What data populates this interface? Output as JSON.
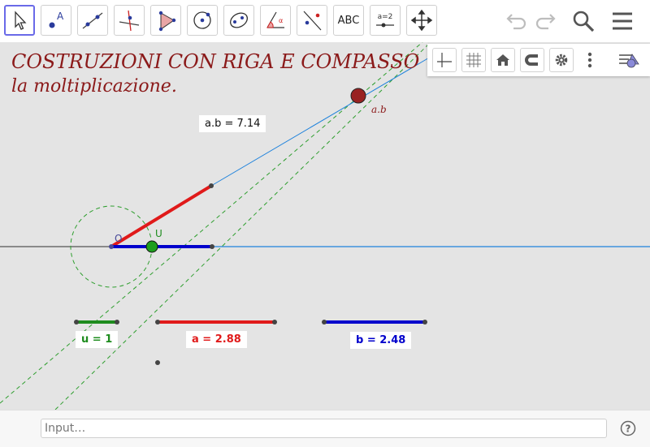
{
  "toolbar": {
    "tools": [
      {
        "name": "move-tool",
        "icon": "cursor-icon"
      },
      {
        "name": "point-tool",
        "icon": "point-icon"
      },
      {
        "name": "line-tool",
        "icon": "line-icon"
      },
      {
        "name": "perpendicular-tool",
        "icon": "perpendicular-icon"
      },
      {
        "name": "polygon-tool",
        "icon": "polygon-icon"
      },
      {
        "name": "circle-tool",
        "icon": "circle-icon"
      },
      {
        "name": "ellipse-tool",
        "icon": "ellipse-icon"
      },
      {
        "name": "angle-tool",
        "icon": "angle-icon"
      },
      {
        "name": "reflect-tool",
        "icon": "reflect-icon"
      },
      {
        "name": "text-tool",
        "icon": "text-icon",
        "label": "ABC"
      },
      {
        "name": "slider-tool",
        "icon": "slider-icon",
        "label": "a=2"
      },
      {
        "name": "move-view-tool",
        "icon": "move-view-icon"
      }
    ]
  },
  "graphics": {
    "title_line1": "COSTRUZIONI CON RIGA E COMPASSO",
    "title_line2": "la  moltiplicazione.",
    "point_labels": {
      "origin": "O",
      "unit": "U",
      "product": "a.b"
    },
    "labels": {
      "u": "u = 1",
      "a": "a = 2.88",
      "b": "b = 2.48",
      "ab": "a.b = 7.14"
    },
    "colors": {
      "u": "#1e8c1e",
      "a": "#e01a1a",
      "b": "#0000cc",
      "ab": "#111111",
      "title": "#8b1a1a",
      "line": "#1e82dc",
      "dashed": "#2e9e2e"
    }
  },
  "input_bar": {
    "placeholder": "Input…",
    "help_icon": "question-icon"
  },
  "style_bar": {
    "buttons": [
      "axes-icon",
      "grid-icon",
      "home-icon",
      "magnet-icon",
      "gear-icon",
      "more-icon",
      "style-bar-toggle-icon"
    ]
  }
}
